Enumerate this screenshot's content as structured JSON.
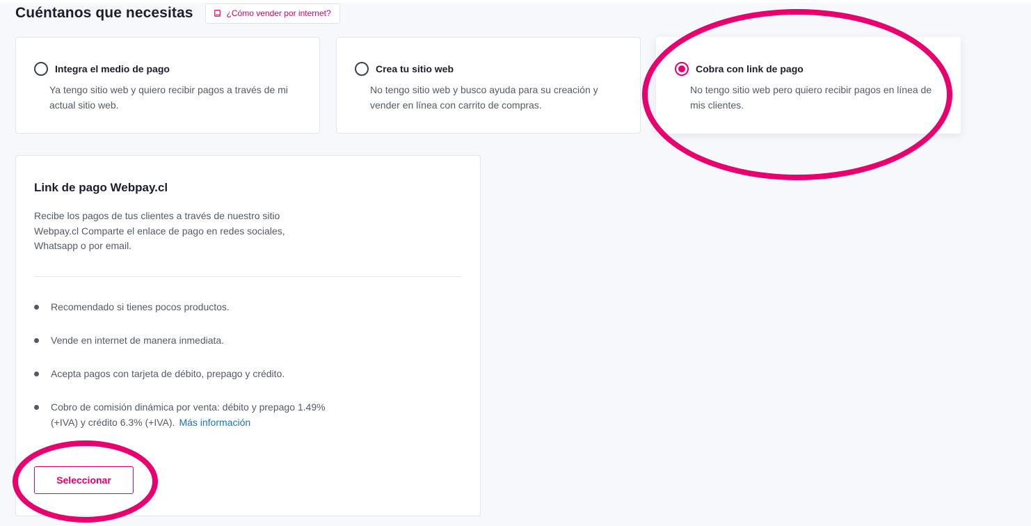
{
  "header": {
    "title": "Cuéntanos que necesitas",
    "help_label": "¿Cómo vender por internet?"
  },
  "options": [
    {
      "title": "Integra el medio de pago",
      "description": "Ya tengo sitio web y quiero recibir pagos a través de mi actual sitio web.",
      "selected": false
    },
    {
      "title": "Crea tu sitio web",
      "description": "No tengo sitio web y busco ayuda para su creación y vender en línea con carrito de compras.",
      "selected": false
    },
    {
      "title": "Cobra con link de pago",
      "description": "No tengo sitio web pero quiero recibir pagos en línea de mis clientes.",
      "selected": true
    }
  ],
  "detail": {
    "title": "Link de pago Webpay.cl",
    "description": "Recibe los pagos de tus clientes a través de nuestro sitio Webpay.cl Comparte el enlace de pago en redes sociales, Whatsapp o por email.",
    "features": [
      "Recomendado si tienes pocos productos.",
      "Vende en internet de manera inmediata.",
      "Acepta pagos con tarjeta de débito, prepago y crédito.",
      "Cobro de comisión dinámica por venta: débito y prepago 1.49% (+IVA) y crédito 6.3% (+IVA)."
    ],
    "more_info_label": "Más información",
    "select_label": "Seleccionar"
  },
  "colors": {
    "accent": "#e5006e",
    "link": "#1673c6",
    "annotation": "#e8006f"
  },
  "icons": {
    "help": "book-icon",
    "bullet": "bullet-dot-icon"
  }
}
